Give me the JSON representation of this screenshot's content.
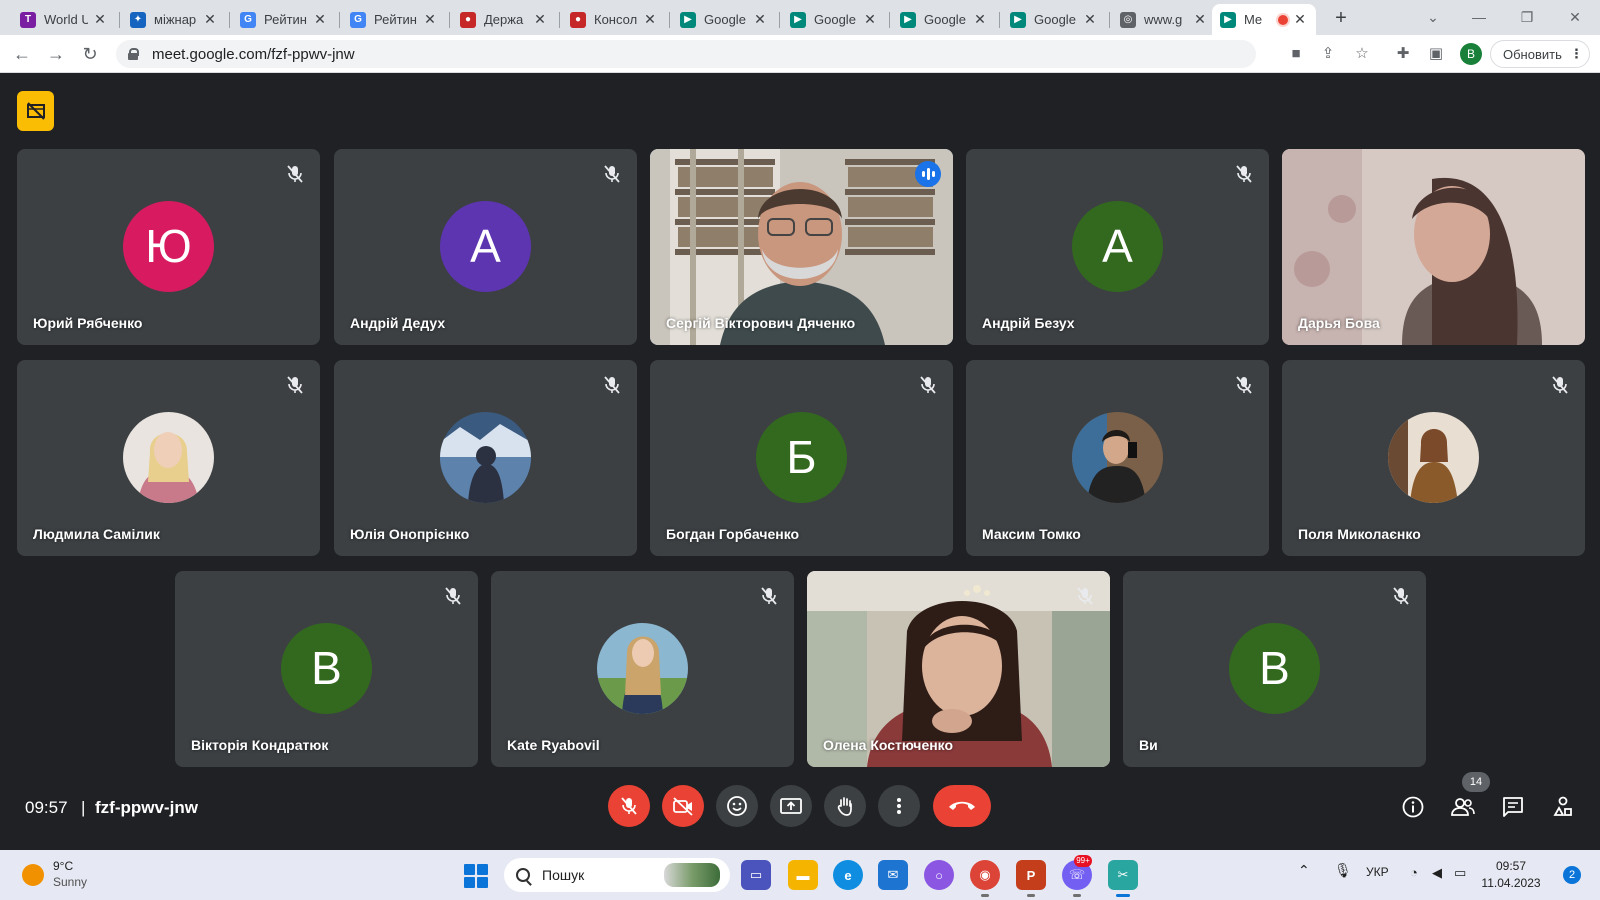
{
  "browser": {
    "tabs": [
      {
        "label": "World U",
        "icon": "times-higher-education-icon",
        "color": "#7b1fa2"
      },
      {
        "label": "міжнар",
        "icon": "bird-icon",
        "color": "#1565c0"
      },
      {
        "label": "Рейтин",
        "icon": "google-search-icon",
        "color": "#4285f4"
      },
      {
        "label": "Рейтин",
        "icon": "google-search-icon",
        "color": "#4285f4"
      },
      {
        "label": "Держа",
        "icon": "red-circle-icon",
        "color": "#c62828"
      },
      {
        "label": "Консол",
        "icon": "red-circle-icon",
        "color": "#c62828"
      },
      {
        "label": "Google",
        "icon": "google-meet-icon",
        "color": "#00897b"
      },
      {
        "label": "Google",
        "icon": "google-meet-icon",
        "color": "#00897b"
      },
      {
        "label": "Google",
        "icon": "google-meet-icon",
        "color": "#00897b"
      },
      {
        "label": "Google",
        "icon": "google-meet-icon",
        "color": "#00897b"
      },
      {
        "label": "www.g",
        "icon": "globe-icon",
        "color": "#5f6368"
      }
    ],
    "active_tab": {
      "label": "Me",
      "icon": "google-meet-icon"
    },
    "url": "meet.google.com/fzf-ppwv-jnw",
    "profile_initial": "B",
    "update_label": "Обновить"
  },
  "meeting": {
    "participants": [
      {
        "name": "Юрий Рябченко",
        "initial": "Ю",
        "avatar_color": "#d81b60",
        "type": "letter",
        "muted": true
      },
      {
        "name": "Андрій Дедух",
        "initial": "А",
        "avatar_color": "#5e35b1",
        "type": "letter",
        "muted": true
      },
      {
        "name": "Сергій Вікторович Дяченко",
        "type": "video",
        "speaking": true,
        "muted": false
      },
      {
        "name": "Андрій Безух",
        "initial": "А",
        "avatar_color": "#33691e",
        "type": "letter",
        "muted": true
      },
      {
        "name": "Дарья Бова",
        "type": "video",
        "muted": false
      },
      {
        "name": "Людмила Самілик",
        "type": "photo",
        "muted": true
      },
      {
        "name": "Юлія Онопрієнко",
        "type": "photo",
        "muted": true
      },
      {
        "name": "Богдан Горбаченко",
        "initial": "Б",
        "avatar_color": "#33691e",
        "type": "letter",
        "muted": true
      },
      {
        "name": "Максим Томко",
        "type": "photo",
        "muted": true
      },
      {
        "name": "Поля Миколаєнко",
        "type": "photo",
        "muted": true
      },
      {
        "name": "Вікторія Кондратюк",
        "initial": "В",
        "avatar_color": "#33691e",
        "type": "letter",
        "muted": true
      },
      {
        "name": "Kate Ryabovil",
        "type": "photo",
        "muted": true
      },
      {
        "name": "Олена Костюченко",
        "type": "video",
        "muted": true
      },
      {
        "name": "Ви",
        "initial": "В",
        "avatar_color": "#33691e",
        "type": "letter",
        "muted": true
      }
    ],
    "time": "09:57",
    "separator": "|",
    "code": "fzf-ppwv-jnw",
    "participant_count": "14",
    "accent_red": "#ea4335",
    "speaking_color": "#8ab4f8"
  },
  "taskbar": {
    "weather_temp": "9°C",
    "weather_condition": "Sunny",
    "search_placeholder": "Пошук",
    "viber_badge": "99+",
    "language": "УКР",
    "clock_time": "09:57",
    "clock_date": "11.04.2023",
    "notification_count": "2"
  }
}
